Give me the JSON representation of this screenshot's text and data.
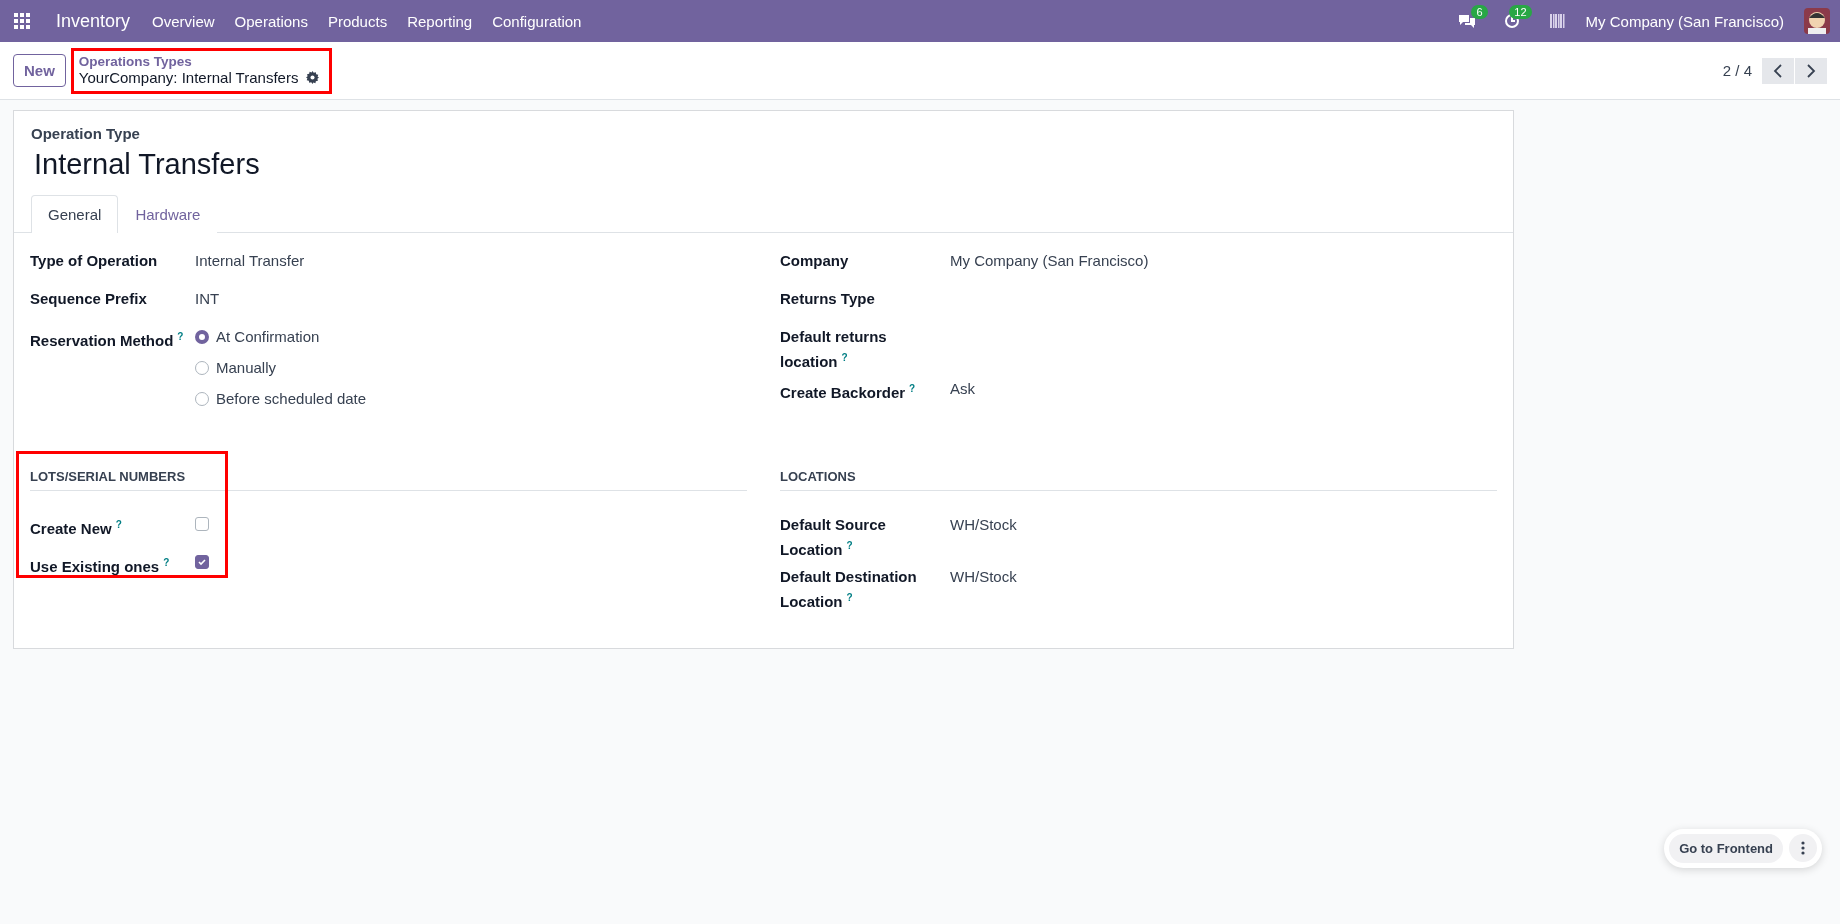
{
  "navbar": {
    "app": "Inventory",
    "menu": [
      "Overview",
      "Operations",
      "Products",
      "Reporting",
      "Configuration"
    ],
    "messages_count": "6",
    "activities_count": "12",
    "company": "My Company (San Francisco)"
  },
  "control_panel": {
    "new_button": "New",
    "breadcrumb_parent": "Operations Types",
    "breadcrumb_current": "YourCompany: Internal Transfers",
    "highlighted": true,
    "pager": "2 / 4"
  },
  "form": {
    "title_label": "Operation Type",
    "title": "Internal Transfers",
    "tabs": [
      {
        "label": "General",
        "selected": true
      },
      {
        "label": "Hardware",
        "selected": false
      }
    ],
    "left_fields": [
      {
        "kind": "text",
        "label": "Type of Operation",
        "value": "Internal Transfer"
      },
      {
        "kind": "text",
        "label": "Sequence Prefix",
        "value": "INT"
      },
      {
        "kind": "radio",
        "label": "Reservation Method",
        "help": "?",
        "options": [
          {
            "label": "At Confirmation",
            "selected": true
          },
          {
            "label": "Manually",
            "selected": false
          },
          {
            "label": "Before scheduled date",
            "selected": false
          }
        ]
      }
    ],
    "right_fields": [
      {
        "kind": "text",
        "label": "Company",
        "value": "My Company (San Francisco)"
      },
      {
        "kind": "text",
        "label": "Returns Type"
      },
      {
        "kind": "text",
        "label": "Default returns location",
        "help": "?"
      },
      {
        "kind": "text",
        "label": "Create Backorder",
        "help": "?",
        "value": "Ask"
      }
    ],
    "lots_section": {
      "title": "LOTS/SERIAL NUMBERS",
      "highlighted": true,
      "fields": [
        {
          "kind": "checkbox",
          "label": "Create New",
          "help": "?",
          "checked": false
        },
        {
          "kind": "checkbox",
          "label": "Use Existing ones",
          "help": "?",
          "checked": true
        }
      ]
    },
    "locations_section": {
      "title": "LOCATIONS",
      "fields": [
        {
          "kind": "text",
          "label": "Default Source Location",
          "help": "?",
          "value": "WH/Stock"
        },
        {
          "kind": "text",
          "label": "Default Destination Location",
          "help": "?",
          "value": "WH/Stock"
        }
      ]
    }
  },
  "frontend_button": "Go to Frontend"
}
